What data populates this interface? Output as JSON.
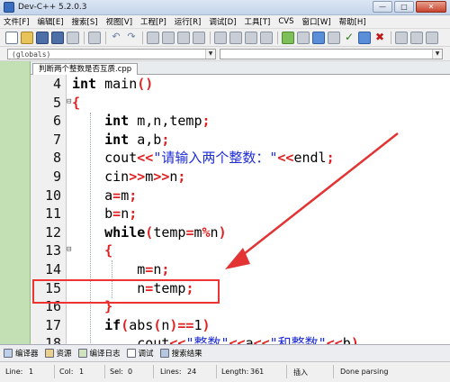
{
  "window": {
    "title": "Dev-C++ 5.2.0.3",
    "controls": [
      "—",
      "□",
      "✕"
    ]
  },
  "menu": [
    "文件[F]",
    "编辑[E]",
    "搜索[S]",
    "视图[V]",
    "工程[P]",
    "运行[R]",
    "调试[D]",
    "工具[T]",
    "CVS",
    "窗口[W]",
    "帮助[H]"
  ],
  "scope": {
    "selected": "(globals)",
    "second": ""
  },
  "file_tab": "判断两个整数是否互质.cpp",
  "editor": {
    "lines": [
      {
        "n": "4",
        "fold": "",
        "html": "<span class='kw'>int</span> main<span class='op'>()</span>"
      },
      {
        "n": "5",
        "fold": "⊟",
        "html": "<span class='op'>{</span>"
      },
      {
        "n": "6",
        "fold": "",
        "html": "    <span class='kw'>int</span> m,n,temp<span class='op'>;</span>"
      },
      {
        "n": "7",
        "fold": "",
        "html": "    <span class='kw'>int</span> a,b<span class='op'>;</span>"
      },
      {
        "n": "8",
        "fold": "",
        "html": "    cout<span class='op'>&lt;&lt;</span><span class='str'>\"请输入两个整数：\"</span><span class='op'>&lt;&lt;</span>endl<span class='op'>;</span>"
      },
      {
        "n": "9",
        "fold": "",
        "html": "    cin<span class='op'>&gt;&gt;</span>m<span class='op'>&gt;&gt;</span>n<span class='op'>;</span>"
      },
      {
        "n": "10",
        "fold": "",
        "html": "    a<span class='op'>=</span>m<span class='op'>;</span>"
      },
      {
        "n": "11",
        "fold": "",
        "html": "    b<span class='op'>=</span>n<span class='op'>;</span>"
      },
      {
        "n": "12",
        "fold": "",
        "html": "    <span class='kw'>while</span><span class='op'>(</span>temp<span class='op'>=</span>m<span class='op'>%</span>n<span class='op'>)</span>"
      },
      {
        "n": "13",
        "fold": "⊟",
        "html": "    <span class='op'>{</span>"
      },
      {
        "n": "14",
        "fold": "",
        "html": "        m<span class='op'>=</span>n<span class='op'>;</span>"
      },
      {
        "n": "15",
        "fold": "",
        "html": "        n<span class='op'>=</span>temp<span class='op'>;</span>"
      },
      {
        "n": "16",
        "fold": "",
        "html": "    <span class='op'>}</span>"
      },
      {
        "n": "17",
        "fold": "",
        "html": "    <span class='kw'>if</span><span class='op'>(</span>abs<span class='op'>(</span>n<span class='op'>)==</span>1<span class='op'>)</span>"
      },
      {
        "n": "18",
        "fold": "",
        "html": "        cout<span class='op'>&lt;&lt;</span><span class='str'>\"整数\"</span><span class='op'>&lt;&lt;</span>a<span class='op'>&lt;&lt;</span><span class='str'>\"和整数\"</span><span class='op'>&lt;&lt;</span>b<span class='op'>)</span>"
      }
    ]
  },
  "bottom_tabs": [
    "编译器",
    "资源",
    "编译日志",
    "调试",
    "搜索结果"
  ],
  "status": {
    "line_label": "Line:",
    "line": "1",
    "col_label": "Col:",
    "col": "1",
    "sel_label": "Sel:",
    "sel": "0",
    "lines_label": "Lines:",
    "lines": "24",
    "length_label": "Length:",
    "length": "361",
    "mode": "插入",
    "message": "Done parsing"
  },
  "colors": {
    "highlight_box": "#e33333",
    "arrow": "#e33333",
    "left_pane": "#c3dfb4"
  }
}
